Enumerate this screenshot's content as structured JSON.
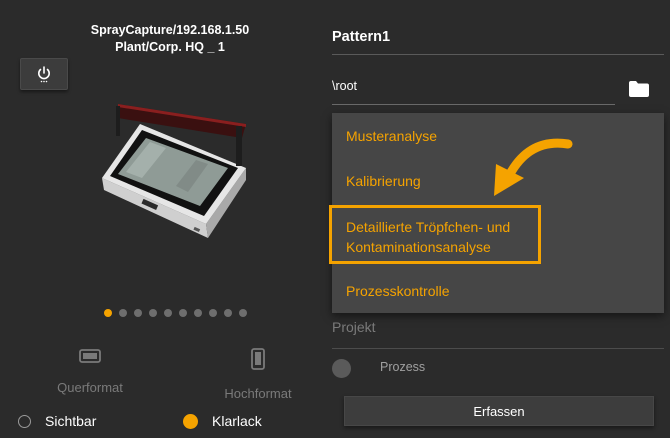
{
  "device": {
    "title_line1": "SprayCapture/192.168.1.50",
    "title_line2": "Plant/Corp. HQ _ 1"
  },
  "carousel": {
    "count": 10,
    "active_index": 0
  },
  "orientation": {
    "landscape_label": "Querformat",
    "portrait_label": "Hochformat"
  },
  "coating": {
    "visible_label": "Sichtbar",
    "clear_label": "Klarlack",
    "selected": "Klarlack"
  },
  "pattern": {
    "name": "Pattern1",
    "path": "\\root"
  },
  "menu": {
    "items": [
      "Musteranalyse",
      "Kalibrierung",
      "Detaillierte Tröpfchen- und Kontaminationsanalyse",
      "Prozesskontrolle"
    ],
    "highlighted_index": 2
  },
  "project": {
    "label": "Projekt",
    "process_label": "Prozess"
  },
  "actions": {
    "capture_label": "Erfassen"
  },
  "colors": {
    "accent": "#f5a300",
    "background": "#2b2b2b",
    "menu_background": "#464646"
  },
  "icons": {
    "power": "power-icon",
    "folder": "folder-icon",
    "landscape": "landscape-icon",
    "portrait": "portrait-icon"
  }
}
